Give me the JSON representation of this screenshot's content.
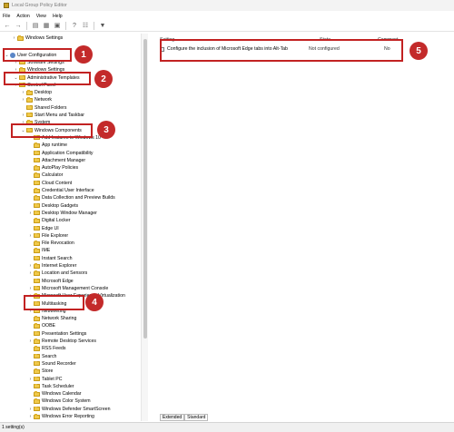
{
  "window": {
    "title": "Local Group Policy Editor"
  },
  "menu": [
    "File",
    "Action",
    "View",
    "Help"
  ],
  "tree": {
    "top": [
      {
        "label": "Windows Settings",
        "exp": ">"
      },
      {
        "label": "User Configuration",
        "exp": "v"
      },
      {
        "label": "Software Settings",
        "exp": ">"
      },
      {
        "label": "Windows Settings",
        "exp": ">"
      },
      {
        "label": "Administrative Templates",
        "exp": "v"
      },
      {
        "label": "Control Panel",
        "exp": ">"
      },
      {
        "label": "Desktop",
        "exp": ">"
      },
      {
        "label": "Network",
        "exp": ">"
      },
      {
        "label": "Shared Folders",
        "exp": ""
      },
      {
        "label": "Start Menu and Taskbar",
        "exp": ">"
      },
      {
        "label": "System",
        "exp": ">"
      },
      {
        "label": "Windows Components",
        "exp": "v"
      }
    ],
    "components": [
      {
        "label": "Add features to Windows 10",
        "exp": ""
      },
      {
        "label": "App runtime",
        "exp": ""
      },
      {
        "label": "Application Compatibility",
        "exp": ""
      },
      {
        "label": "Attachment Manager",
        "exp": ""
      },
      {
        "label": "AutoPlay Policies",
        "exp": ""
      },
      {
        "label": "Calculator",
        "exp": ""
      },
      {
        "label": "Cloud Content",
        "exp": ""
      },
      {
        "label": "Credential User Interface",
        "exp": ""
      },
      {
        "label": "Data Collection and Preview Builds",
        "exp": ""
      },
      {
        "label": "Desktop Gadgets",
        "exp": ""
      },
      {
        "label": "Desktop Window Manager",
        "exp": ">"
      },
      {
        "label": "Digital Locker",
        "exp": ""
      },
      {
        "label": "Edge UI",
        "exp": ""
      },
      {
        "label": "File Explorer",
        "exp": ">"
      },
      {
        "label": "File Revocation",
        "exp": ""
      },
      {
        "label": "IME",
        "exp": ""
      },
      {
        "label": "Instant Search",
        "exp": ""
      },
      {
        "label": "Internet Explorer",
        "exp": ">"
      },
      {
        "label": "Location and Sensors",
        "exp": ">"
      },
      {
        "label": "Microsoft Edge",
        "exp": ""
      },
      {
        "label": "Microsoft Management Console",
        "exp": ">"
      },
      {
        "label": "Microsoft User Experience Virtualization",
        "exp": ">"
      },
      {
        "label": "Multitasking",
        "exp": ""
      },
      {
        "label": "NetMeeting",
        "exp": ">"
      },
      {
        "label": "Network Sharing",
        "exp": ""
      },
      {
        "label": "OOBE",
        "exp": ""
      },
      {
        "label": "Presentation Settings",
        "exp": ""
      },
      {
        "label": "Remote Desktop Services",
        "exp": ">"
      },
      {
        "label": "RSS Feeds",
        "exp": ""
      },
      {
        "label": "Search",
        "exp": ""
      },
      {
        "label": "Sound Recorder",
        "exp": ""
      },
      {
        "label": "Store",
        "exp": ""
      },
      {
        "label": "Tablet PC",
        "exp": ">"
      },
      {
        "label": "Task Scheduler",
        "exp": ""
      },
      {
        "label": "Windows Calendar",
        "exp": ""
      },
      {
        "label": "Windows Color System",
        "exp": ""
      },
      {
        "label": "Windows Defender SmartScreen",
        "exp": ">"
      },
      {
        "label": "Windows Error Reporting",
        "exp": ">"
      }
    ]
  },
  "list": {
    "headers": {
      "setting": "Setting",
      "state": "State",
      "comment": "Comment"
    },
    "rows": [
      {
        "setting": "Configure the inclusion of Microsoft Edge tabs into Alt-Tab",
        "state": "Not configured",
        "comment": "No"
      }
    ]
  },
  "tabs": [
    "Extended",
    "Standard"
  ],
  "status": "1 setting(s)",
  "badges": [
    "1",
    "2",
    "3",
    "4",
    "5"
  ],
  "colors": {
    "highlight": "#c22222",
    "badge": "#c32a2a",
    "folder": "#f0c94a"
  }
}
